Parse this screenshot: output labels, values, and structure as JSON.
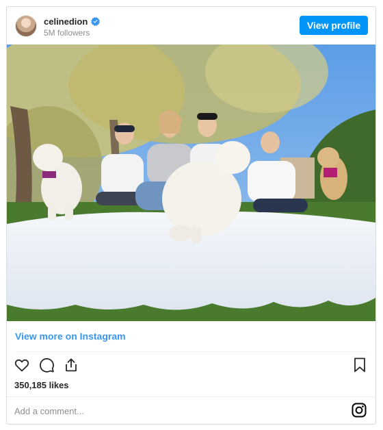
{
  "header": {
    "username": "celinedion",
    "followers": "5M followers",
    "view_profile_label": "View profile",
    "verified": true,
    "verified_color": "#3897f0"
  },
  "post": {
    "image_alt": "",
    "view_more_label": "View more on Instagram",
    "likes": "350,185 likes",
    "comment_placeholder": "Add a comment..."
  },
  "icons": {
    "like": "heart-icon",
    "comment": "comment-icon",
    "share": "share-icon",
    "save": "bookmark-icon",
    "instagram": "instagram-logo-icon"
  },
  "colors": {
    "accent": "#0095f6",
    "link": "#3897f0",
    "muted": "#8e8e8e"
  }
}
